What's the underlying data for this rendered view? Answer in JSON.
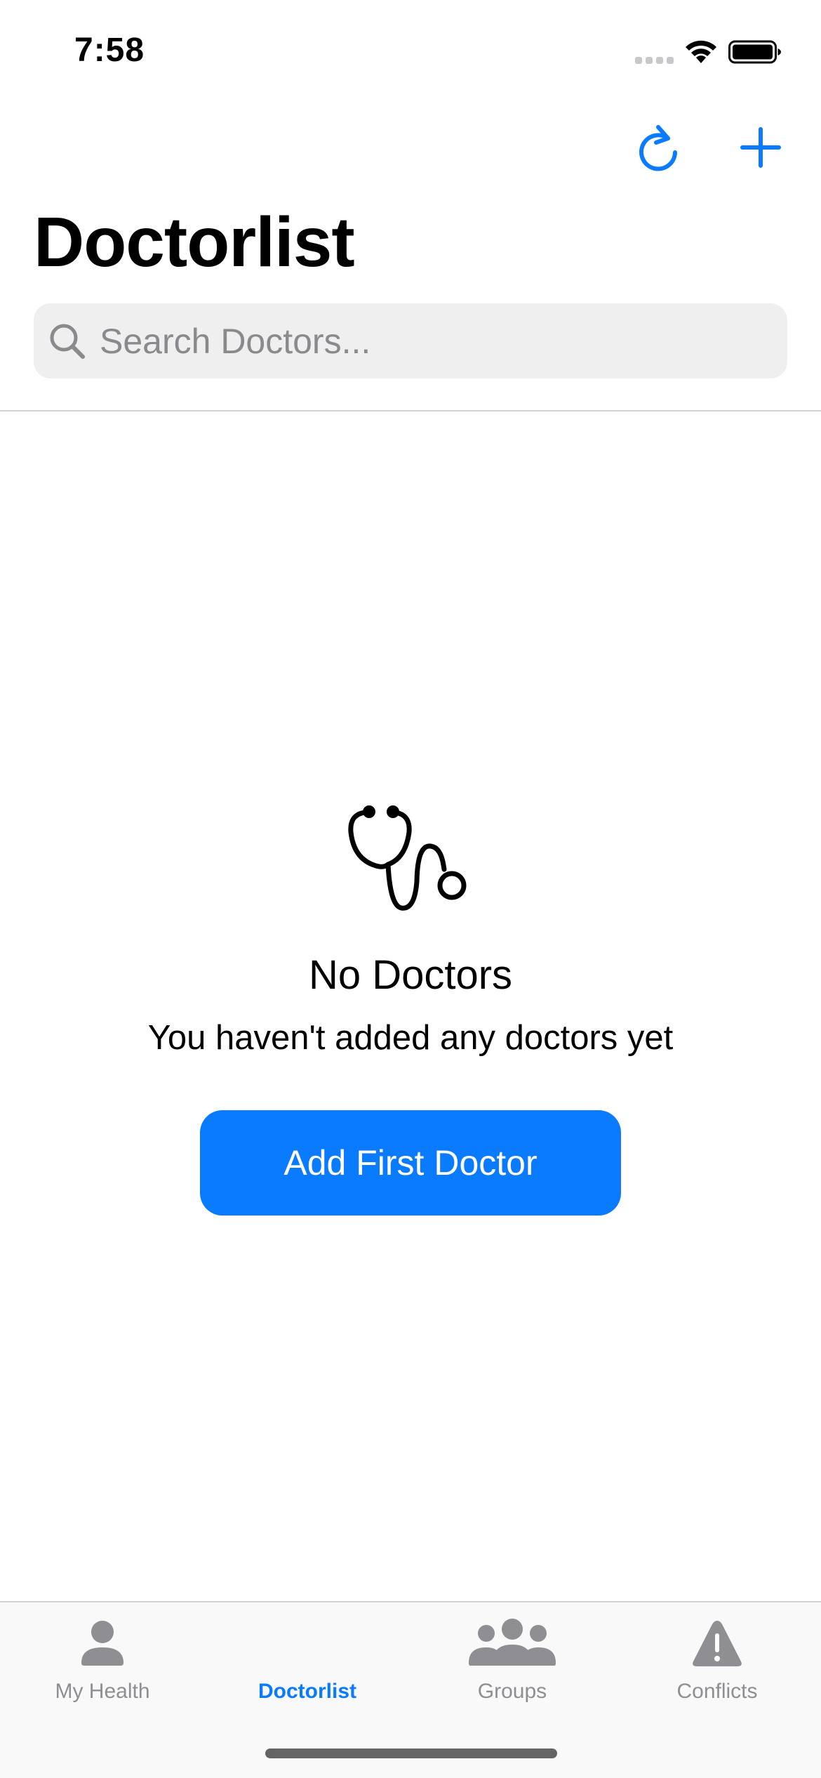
{
  "status_bar": {
    "time": "7:58"
  },
  "nav": {
    "refresh_icon": "arrow-clockwise-icon",
    "add_icon": "plus-icon",
    "title": "Doctorlist"
  },
  "search": {
    "placeholder": "Search Doctors...",
    "value": "",
    "icon": "magnifying-glass-icon"
  },
  "empty_state": {
    "icon": "stethoscope-icon",
    "title": "No Doctors",
    "subtitle": "You haven't added any doctors yet",
    "button_label": "Add First Doctor"
  },
  "tabs": [
    {
      "label": "My Health",
      "icon": "person-icon",
      "active": false
    },
    {
      "label": "Doctorlist",
      "icon": "stethoscope-icon",
      "active": true
    },
    {
      "label": "Groups",
      "icon": "person-3-icon",
      "active": false
    },
    {
      "label": "Conflicts",
      "icon": "exclamation-triangle-icon",
      "active": false
    }
  ],
  "colors": {
    "accent": "#0a7aff",
    "tab_inactive": "#8e8e93",
    "search_bg": "#efeff0",
    "text": "#000000"
  }
}
